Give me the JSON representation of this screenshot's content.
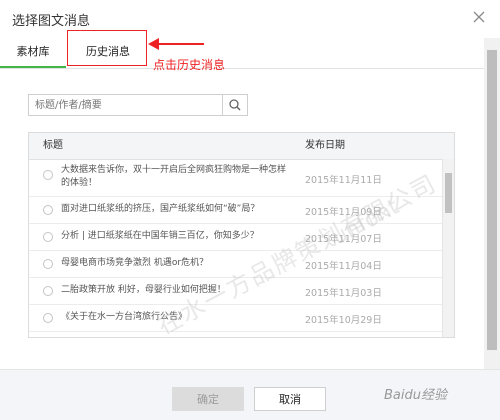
{
  "dialog": {
    "title": "选择图文消息"
  },
  "tabs": [
    {
      "label": "素材库",
      "active": true
    },
    {
      "label": "历史消息",
      "active": false
    }
  ],
  "annotation": {
    "text": "点击历史消息",
    "color": "#e22222"
  },
  "search": {
    "placeholder": "标题/作者/摘要"
  },
  "table": {
    "headers": [
      "标题",
      "发布日期"
    ],
    "rows": [
      {
        "title": "大数据来告诉你，双十一开启后全网疯狂购物是一种怎样的体验！",
        "date": "2015年11月11日"
      },
      {
        "title": "面对进口纸浆纸的挤压，国产纸浆纸如何“破”局？",
        "date": "2015年11月09日"
      },
      {
        "title": "分析 | 进口纸浆纸在中国年销三百亿，你知多少？",
        "date": "2015年11月07日"
      },
      {
        "title": "母婴电商市场竞争激烈 机遇or危机？",
        "date": "2015年11月04日"
      },
      {
        "title": "二胎政策开放 利好，母婴行业如何把握！",
        "date": "2015年11月03日"
      },
      {
        "title": "《关于在水一方台湾旅行公告》",
        "date": "2015年10月29日"
      }
    ]
  },
  "footer": {
    "ok_label": "确定",
    "cancel_label": "取消"
  },
  "watermark": {
    "brand": "在水一方品牌策划有限公司",
    "baidu": "Baidu经验"
  },
  "colors": {
    "accent": "#44b549",
    "annotation": "#e22222"
  }
}
